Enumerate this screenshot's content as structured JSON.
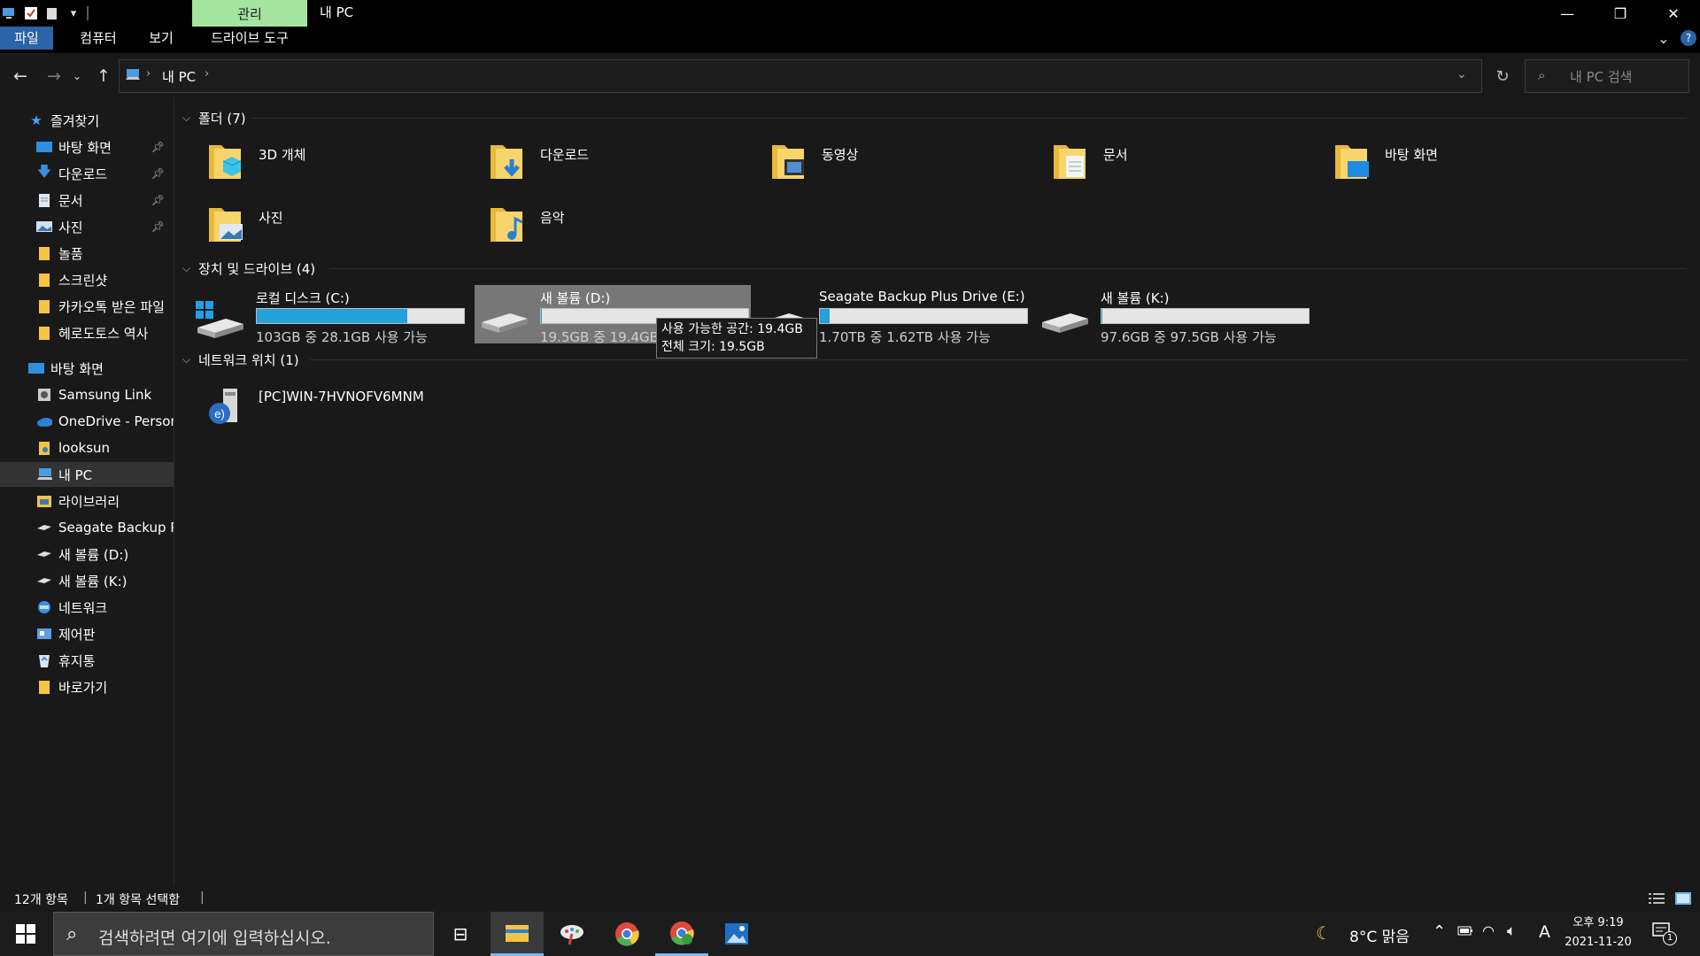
{
  "window": {
    "title": "내 PC",
    "contextual_tab": "관리",
    "controls": {
      "minimize": "—",
      "restore": "❐",
      "close": "✕"
    }
  },
  "ribbon": {
    "tabs": [
      "파일",
      "컴퓨터",
      "보기",
      "드라이브 도구"
    ],
    "active_tab": "파일",
    "help": "?"
  },
  "address": {
    "path": [
      "내 PC"
    ],
    "search_placeholder": "내 PC 검색"
  },
  "sidebar": {
    "quick_access": "즐겨찾기",
    "pinned": [
      {
        "label": "바탕 화면",
        "icon": "desktop-icon",
        "pinned": true
      },
      {
        "label": "다운로드",
        "icon": "download-icon",
        "pinned": true
      },
      {
        "label": "문서",
        "icon": "document-icon",
        "pinned": true
      },
      {
        "label": "사진",
        "icon": "pictures-icon",
        "pinned": true
      },
      {
        "label": "놀품",
        "icon": "folder-icon",
        "pinned": false
      },
      {
        "label": "스크린샷",
        "icon": "folder-icon",
        "pinned": false
      },
      {
        "label": "카카오톡 받은 파일",
        "icon": "folder-icon",
        "pinned": false
      },
      {
        "label": "헤로도토스 역사",
        "icon": "folder-icon",
        "pinned": false
      }
    ],
    "desktop": "바탕 화면",
    "desktop_items": [
      {
        "label": "Samsung Link",
        "icon": "samsung-link-icon"
      },
      {
        "label": "OneDrive - Persona",
        "icon": "onedrive-icon"
      },
      {
        "label": "looksun",
        "icon": "user-folder-icon"
      },
      {
        "label": "내 PC",
        "icon": "this-pc-icon",
        "selected": true
      },
      {
        "label": "라이브러리",
        "icon": "library-icon"
      },
      {
        "label": "Seagate Backup Plu",
        "icon": "drive-icon"
      },
      {
        "label": "새 볼륨 (D:)",
        "icon": "drive-icon"
      },
      {
        "label": "새 볼륨 (K:)",
        "icon": "drive-icon"
      },
      {
        "label": "네트워크",
        "icon": "network-icon"
      },
      {
        "label": "제어판",
        "icon": "control-panel-icon"
      },
      {
        "label": "휴지통",
        "icon": "recycle-bin-icon"
      },
      {
        "label": "바로가기",
        "icon": "folder-icon"
      }
    ]
  },
  "content": {
    "folders_header": "폴더 (7)",
    "folders": [
      {
        "label": "3D 개체",
        "icon": "3d-objects-folder-icon"
      },
      {
        "label": "다운로드",
        "icon": "downloads-folder-icon"
      },
      {
        "label": "동영상",
        "icon": "videos-folder-icon"
      },
      {
        "label": "문서",
        "icon": "documents-folder-icon"
      },
      {
        "label": "바탕 화면",
        "icon": "desktop-folder-icon"
      },
      {
        "label": "사진",
        "icon": "pictures-folder-icon"
      },
      {
        "label": "음악",
        "icon": "music-folder-icon"
      }
    ],
    "drives_header": "장치 및 드라이브 (4)",
    "drives": [
      {
        "name": "로컬 디스크 (C:)",
        "info": "103GB 중 28.1GB 사용 가능",
        "used_fraction": 0.727,
        "icon": "windows-drive-icon"
      },
      {
        "name": "새 볼륨 (D:)",
        "info": "19.5GB 중 19.4GB 사용 가능",
        "used_fraction": 0.005,
        "icon": "drive-icon",
        "hovered": true
      },
      {
        "name": "Seagate Backup Plus Drive (E:)",
        "info": "1.70TB 중 1.62TB 사용 가능",
        "used_fraction": 0.047,
        "icon": "drive-icon"
      },
      {
        "name": "새 볼륨 (K:)",
        "info": "97.6GB 중 97.5GB 사용 가능",
        "used_fraction": 0.001,
        "icon": "drive-icon"
      }
    ],
    "tooltip": {
      "line1": "사용 가능한 공간: 19.4GB",
      "line2": "전체 크기: 19.5GB"
    },
    "network_header": "네트워크 위치 (1)",
    "network_items": [
      {
        "label": "[PC]WIN-7HVNOFV6MNM",
        "icon": "network-drive-icon"
      }
    ]
  },
  "status": {
    "count": "12개 항목",
    "selected": "1개 항목 선택함"
  },
  "taskbar": {
    "search_placeholder": "검색하려면 여기에 입력하십시오.",
    "apps": [
      "file-explorer-icon",
      "paint-icon",
      "chrome-icon",
      "chrome-profile-icon",
      "photos-icon"
    ],
    "weather": "8°C 맑음",
    "ime": "A",
    "time": "오후 9:19",
    "date": "2021-11-20",
    "notifications": "1"
  },
  "colors": {
    "accent": "#2b64a8",
    "progress": "#26a0da",
    "context_tab": "#a5e5a0",
    "background": "#191919"
  }
}
